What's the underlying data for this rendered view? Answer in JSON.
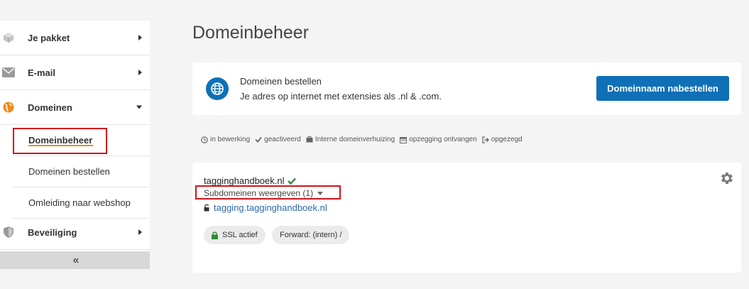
{
  "sidebar": {
    "items": [
      {
        "label": "Je pakket",
        "icon": "box-icon"
      },
      {
        "label": "E-mail",
        "icon": "envelope-icon"
      },
      {
        "label": "Domeinen",
        "icon": "globe-icon"
      },
      {
        "label": "Beveiliging",
        "icon": "shield-icon"
      }
    ],
    "subitems": [
      {
        "label": "Domeinbeheer"
      },
      {
        "label": "Domeinen bestellen"
      },
      {
        "label": "Omleiding naar webshop"
      }
    ],
    "collapse_label": "«"
  },
  "main": {
    "title": "Domeinbeheer",
    "order_card": {
      "title": "Domeinen bestellen",
      "description": "Je adres op internet met extensies als .nl & .com.",
      "button_label": "Domeinnaam nabestellen"
    },
    "legend": [
      {
        "label": "in bewerking",
        "icon": "clock-icon"
      },
      {
        "label": "geactiveerd",
        "icon": "check-icon"
      },
      {
        "label": "Interne domeinverhuizing",
        "icon": "briefcase-icon"
      },
      {
        "label": "opzegging ontvangen",
        "icon": "calendar-icon"
      },
      {
        "label": "opgezegd",
        "icon": "sign-out-icon"
      }
    ],
    "domain_card": {
      "domain": "tagginghandboek.nl",
      "subdomains_toggle": "Subdomeinen weergeven (1)",
      "subdomain": "tagging.tagginghandboek.nl",
      "badges": [
        {
          "label": "SSL actief",
          "icon": "lock-icon"
        },
        {
          "label": "Forward: (intern) /"
        }
      ]
    }
  },
  "colors": {
    "accent": "#0f70b7",
    "active_underline": "#ee8a1a",
    "check_green": "#2e8b3a",
    "highlight_red": "#d0141c"
  }
}
